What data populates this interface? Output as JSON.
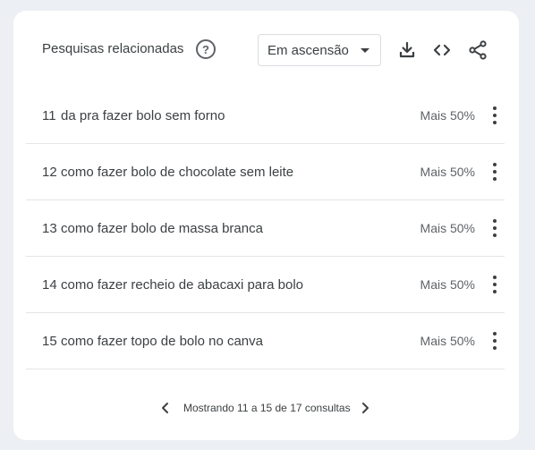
{
  "header": {
    "title": "Pesquisas relacionadas",
    "help_glyph": "?",
    "select_value": "Em ascensão"
  },
  "icons": {
    "help": "help-circle-icon",
    "dropdown": "caret-down-icon",
    "download": "download-icon",
    "embed": "code-icon",
    "share": "share-icon",
    "more": "more-vert-icon",
    "prev": "chevron-left-icon",
    "next": "chevron-right-icon"
  },
  "rows": [
    {
      "rank": "11",
      "query": "da pra fazer bolo sem forno",
      "value": "Mais 50%"
    },
    {
      "rank": "12",
      "query": "como fazer bolo de chocolate sem leite",
      "value": "Mais 50%"
    },
    {
      "rank": "13",
      "query": "como fazer bolo de massa branca",
      "value": "Mais 50%"
    },
    {
      "rank": "14",
      "query": "como fazer recheio de abacaxi para bolo",
      "value": "Mais 50%"
    },
    {
      "rank": "15",
      "query": "como fazer topo de bolo no canva",
      "value": "Mais 50%"
    }
  ],
  "pager": {
    "label": "Mostrando 11 a 15 de 17 consultas"
  },
  "colors": {
    "text": "#3c4043",
    "muted": "#5f6368",
    "divider": "#e3e5e8",
    "background": "#eceff3"
  }
}
